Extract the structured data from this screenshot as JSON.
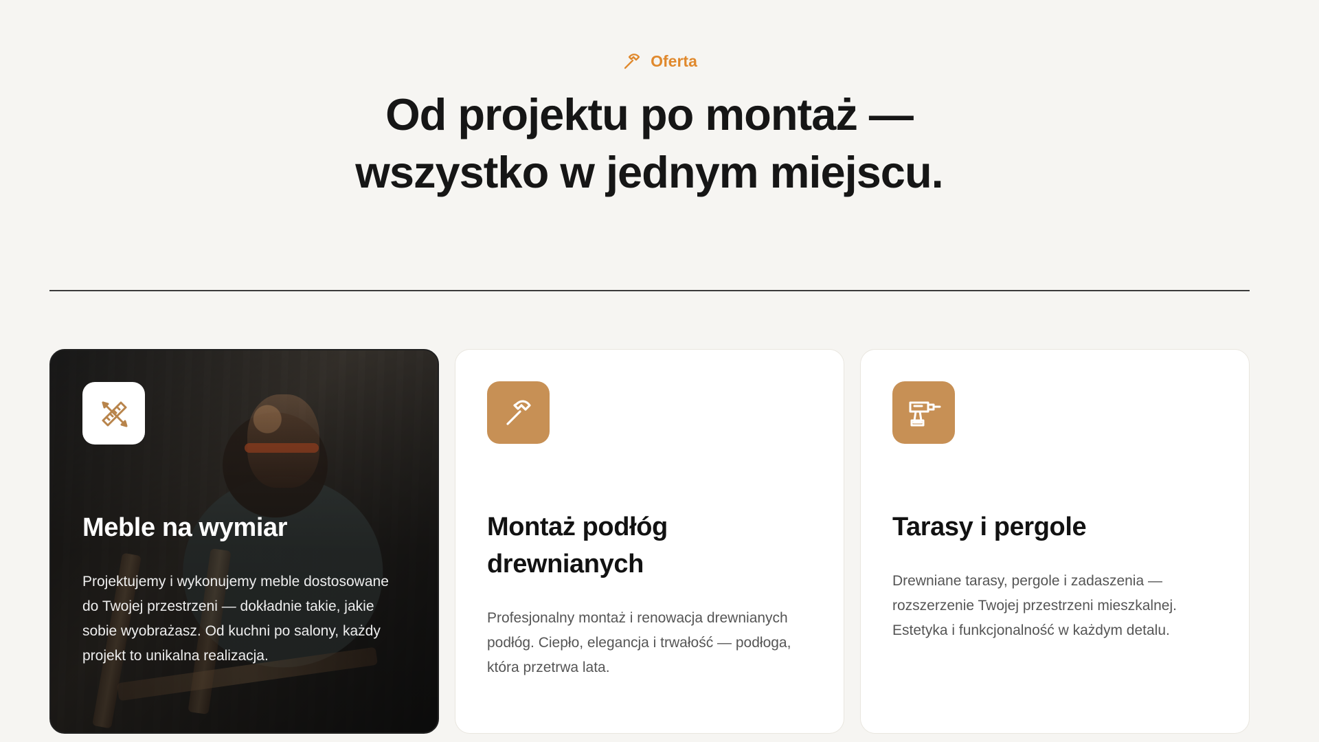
{
  "section": {
    "eyebrow": "Oferta",
    "headline": "Od projektu po montaż — wszystko w jednym miejscu."
  },
  "cards": [
    {
      "title": "Meble na wymiar",
      "description": "Projektujemy i wykonujemy meble dostosowane do Twojej przestrzeni — dokładnie takie, jakie sobie wyobrażasz. Od kuchni po salony, każdy projekt to unikalna realizacja.",
      "icon": "ruler-pencil-icon"
    },
    {
      "title": "Montaż podłóg drewnianych",
      "description": "Profesjonalny montaż i renowacja drewnianych podłóg. Ciepło, elegancja i trwałość — podłoga, która przetrwa lata.",
      "icon": "hammer-icon"
    },
    {
      "title": "Tarasy i pergole",
      "description": "Drewniane tarasy, pergole i zadaszenia — rozszerzenie Twojej przestrzeni mieszkalnej. Estetyka i funkcjonalność w każdym detalu.",
      "icon": "drill-icon"
    }
  ],
  "colors": {
    "background": "#f6f5f2",
    "accent": "#e0892d",
    "card_icon_background": "#c79055",
    "text": "#121212",
    "muted_text": "#555555"
  }
}
